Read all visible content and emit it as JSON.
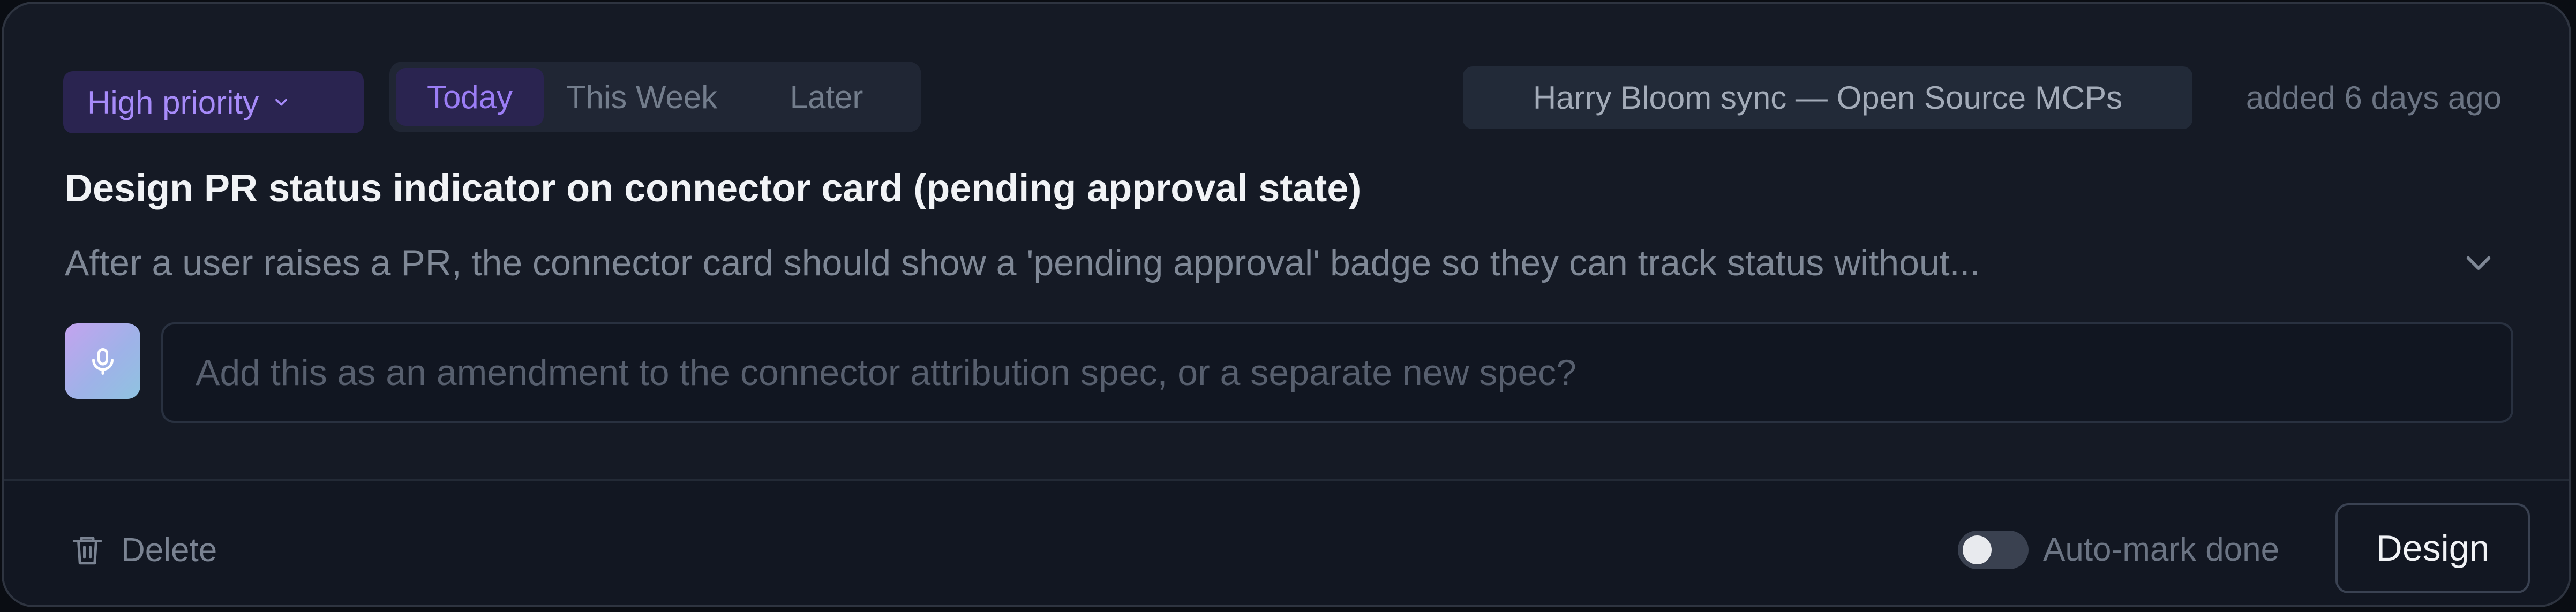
{
  "priority": {
    "label": "High priority",
    "icon": "chevron-down-icon"
  },
  "timeframe": {
    "options": [
      "Today",
      "This Week",
      "Later"
    ],
    "selected": "Today"
  },
  "source_chip": "Harry Bloom sync — Open Source MCPs",
  "added": "added 6 days ago",
  "task": {
    "title": "Design PR status indicator on connector card (pending approval state)",
    "description": "After a user raises a PR, the connector card should show a 'pending approval' badge so they can track status without..."
  },
  "reply": {
    "placeholder": "Add this as an amendment to the connector attribution spec, or a separate new spec?",
    "value": ""
  },
  "footer": {
    "delete_label": "Delete",
    "auto_mark_label": "Auto-mark done",
    "auto_mark_on": false,
    "design_label": "Design"
  },
  "colors": {
    "accent": "#a78bfa",
    "accent_bg": "#2a2450",
    "card_bg": "#151a25",
    "footer_bg": "#121722"
  }
}
